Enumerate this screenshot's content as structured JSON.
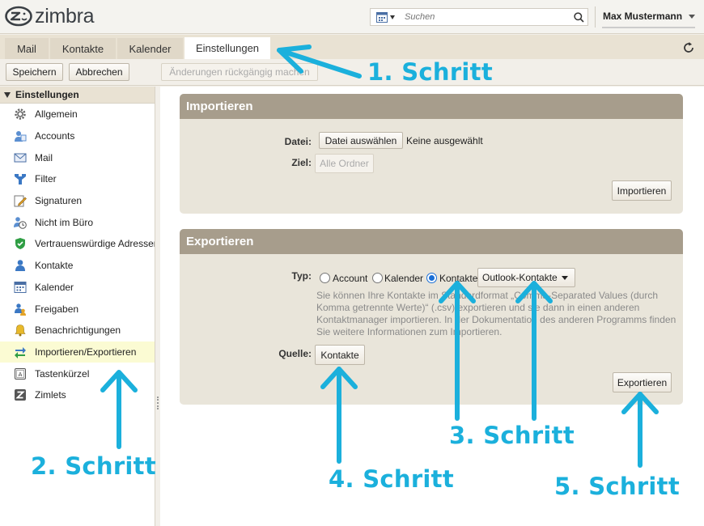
{
  "app": {
    "logo_text": "zimbra",
    "brand_color": "#3a3f44",
    "accent_color": "#1bb0dc"
  },
  "search": {
    "placeholder": "Suchen",
    "type_icon": "calendar-icon",
    "button_icon": "search-icon"
  },
  "user": {
    "name": "Max Mustermann"
  },
  "tabs": [
    {
      "label": "Mail",
      "active": false
    },
    {
      "label": "Kontakte",
      "active": false
    },
    {
      "label": "Kalender",
      "active": false
    },
    {
      "label": "Einstellungen",
      "active": true
    }
  ],
  "toolbar": {
    "save_label": "Speichern",
    "cancel_label": "Abbrechen",
    "undo_label": "Änderungen rückgängig machen"
  },
  "sidebar": {
    "header": "Einstellungen",
    "items": [
      {
        "label": "Allgemein",
        "icon": "gear-icon"
      },
      {
        "label": "Accounts",
        "icon": "accounts-icon"
      },
      {
        "label": "Mail",
        "icon": "mail-icon"
      },
      {
        "label": "Filter",
        "icon": "filter-icon"
      },
      {
        "label": "Signaturen",
        "icon": "signature-icon"
      },
      {
        "label": "Nicht im Büro",
        "icon": "out-of-office-icon"
      },
      {
        "label": "Vertrauenswürdige Adressen",
        "icon": "shield-icon"
      },
      {
        "label": "Kontakte",
        "icon": "contact-icon"
      },
      {
        "label": "Kalender",
        "icon": "calendar-icon"
      },
      {
        "label": "Freigaben",
        "icon": "sharing-icon"
      },
      {
        "label": "Benachrichtigungen",
        "icon": "bell-icon"
      },
      {
        "label": "Importieren/Exportieren",
        "icon": "import-export-icon",
        "selected": true
      },
      {
        "label": "Tastenkürzel",
        "icon": "keyboard-icon"
      },
      {
        "label": "Zimlets",
        "icon": "zimlet-icon"
      }
    ]
  },
  "import": {
    "title": "Importieren",
    "file_label": "Datei:",
    "file_button": "Datei auswählen",
    "file_status": "Keine ausgewählt",
    "target_label": "Ziel:",
    "target_button": "Alle Ordner",
    "import_button": "Importieren"
  },
  "export": {
    "title": "Exportieren",
    "type_label": "Typ:",
    "options": [
      "Account",
      "Kalender",
      "Kontakte"
    ],
    "selected_option": "Kontakte",
    "format_select": "Outlook-Kontakte",
    "description": "Sie können Ihre Kontakte im Standardformat „Comma-Separated Values (durch Komma getrennte Werte)“ (.csv) exportieren und sie dann in einen anderen Kontaktmanager importieren. In der Dokumentation des anderen Programms finden Sie weitere Informationen zum Importieren.",
    "source_label": "Quelle:",
    "source_button": "Kontakte",
    "export_button": "Exportieren"
  },
  "annotations": [
    "1. Schritt",
    "2. Schritt",
    "3. Schritt",
    "4. Schritt",
    "5. Schritt"
  ]
}
